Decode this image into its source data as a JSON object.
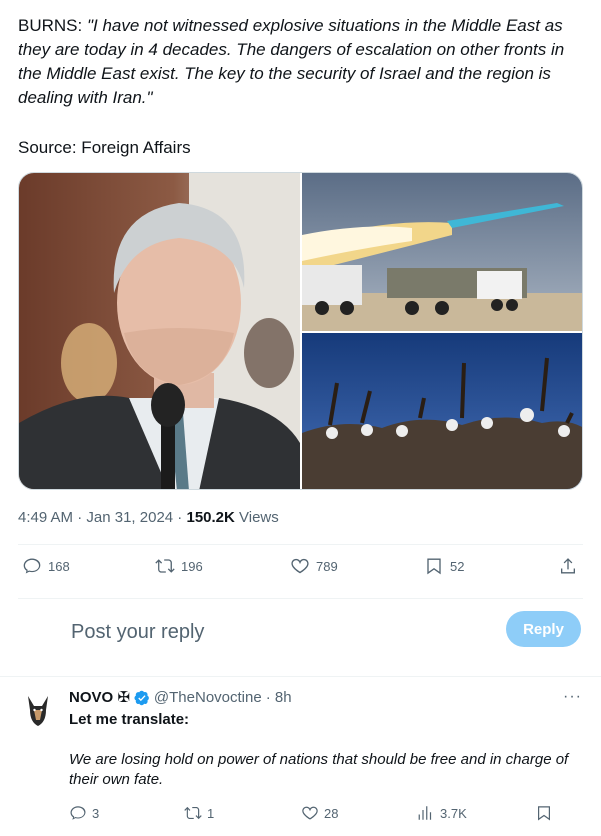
{
  "tweet": {
    "author_prefix": "BURNS: ",
    "quote": "\"I have not witnessed explosive situations in the Middle East as they are today in 4 decades. The dangers of escalation on other fronts in the Middle East exist. The key to the security of Israel and the region is dealing with Iran.\"",
    "source": "Source: Foreign Affairs",
    "time": "4:49 AM",
    "separator": " · ",
    "date": "Jan 31, 2024",
    "views_count": "150.2K",
    "views_label": " Views"
  },
  "actions": {
    "replies": "168",
    "reposts": "196",
    "likes": "789",
    "bookmarks": "52"
  },
  "compose": {
    "placeholder": "Post your reply",
    "button": "Reply"
  },
  "reply": {
    "name": "NOVO ✠",
    "handle": "@TheNovoctine",
    "time": "· 8h",
    "more": "···",
    "line1": "Let me translate:",
    "body": "We are losing hold on power of nations that should be free and in charge of their own fate.",
    "replies": "3",
    "reposts": "1",
    "likes": "28",
    "views": "3.7K"
  },
  "colors": {
    "text": "#0f1419",
    "muted": "#536471",
    "accent": "#1d9bf0",
    "reply_button_disabled": "#8ecdf8"
  },
  "icons": [
    "reply-icon",
    "repost-icon",
    "like-icon",
    "bookmark-icon",
    "share-icon",
    "verified-badge-icon",
    "more-icon",
    "views-icon"
  ]
}
